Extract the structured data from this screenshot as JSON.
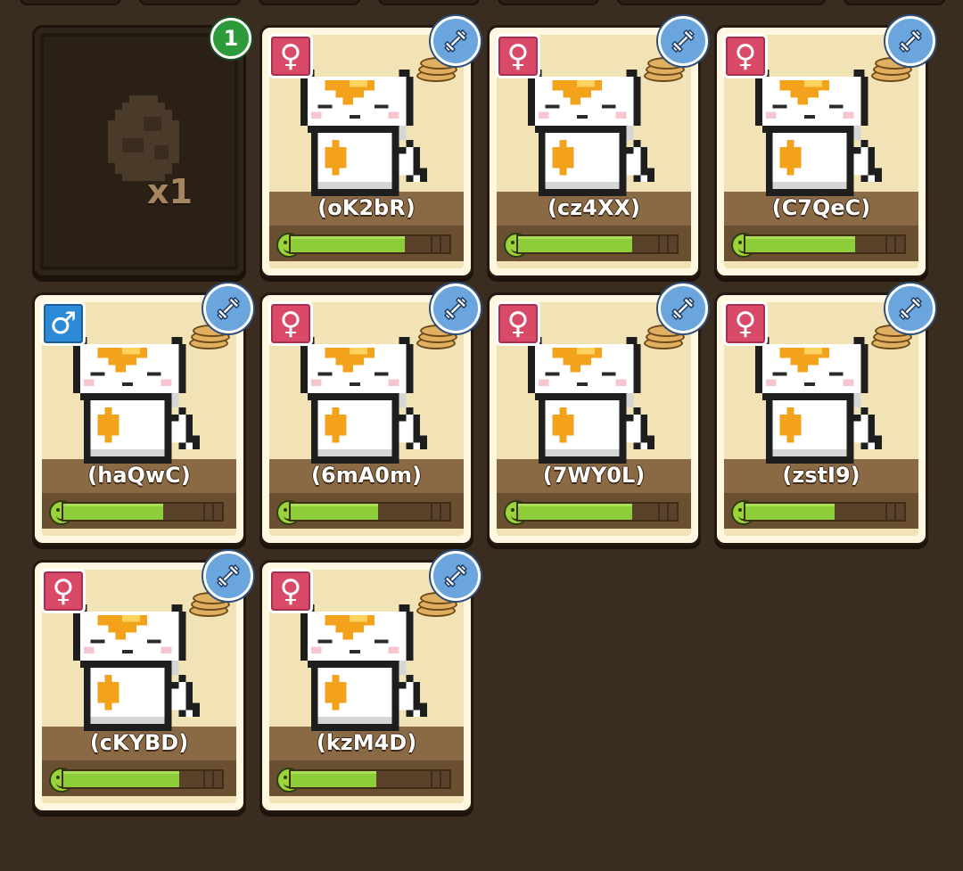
{
  "egg_slot": {
    "quantity_label": "x1",
    "badge_count": "1"
  },
  "pets": [
    {
      "name": "(oK2bR)",
      "gender": "female",
      "gender_icon": "female-icon",
      "happiness": 0.72,
      "bar_segments": 3
    },
    {
      "name": "(cz4XX)",
      "gender": "female",
      "gender_icon": "female-icon",
      "happiness": 0.72,
      "bar_segments": 3
    },
    {
      "name": "(C7QeC)",
      "gender": "female",
      "gender_icon": "female-icon",
      "happiness": 0.69,
      "bar_segments": 3
    },
    {
      "name": "(haQwC)",
      "gender": "male",
      "gender_icon": "male-icon",
      "happiness": 0.63,
      "bar_segments": 3
    },
    {
      "name": "(6mA0m)",
      "gender": "female",
      "gender_icon": "female-icon",
      "happiness": 0.55,
      "bar_segments": 3
    },
    {
      "name": "(7WY0L)",
      "gender": "female",
      "gender_icon": "female-icon",
      "happiness": 0.72,
      "bar_segments": 3
    },
    {
      "name": "(zstI9)",
      "gender": "female",
      "gender_icon": "female-icon",
      "happiness": 0.56,
      "bar_segments": 3
    },
    {
      "name": "(cKYBD)",
      "gender": "female",
      "gender_icon": "female-icon",
      "happiness": 0.73,
      "bar_segments": 3
    },
    {
      "name": "(kzM4D)",
      "gender": "female",
      "gender_icon": "female-icon",
      "happiness": 0.54,
      "bar_segments": 3
    }
  ],
  "icons": {
    "trait_badge": "dumbbell-icon",
    "mood": "smiley-icon",
    "coins": "coin-stack-icon",
    "egg": "egg-icon"
  },
  "colors": {
    "background": "#3a2c1f",
    "card_frame": "#fff7df",
    "card_inner": "#f2e3b6",
    "name_band": "#8a6a45",
    "happiness_fill": "#8dcd3a",
    "female_badge": "#d94a69",
    "male_badge": "#2d8ad6",
    "trait_badge": "#6aa5dd",
    "count_badge": "#2e9b3a"
  }
}
